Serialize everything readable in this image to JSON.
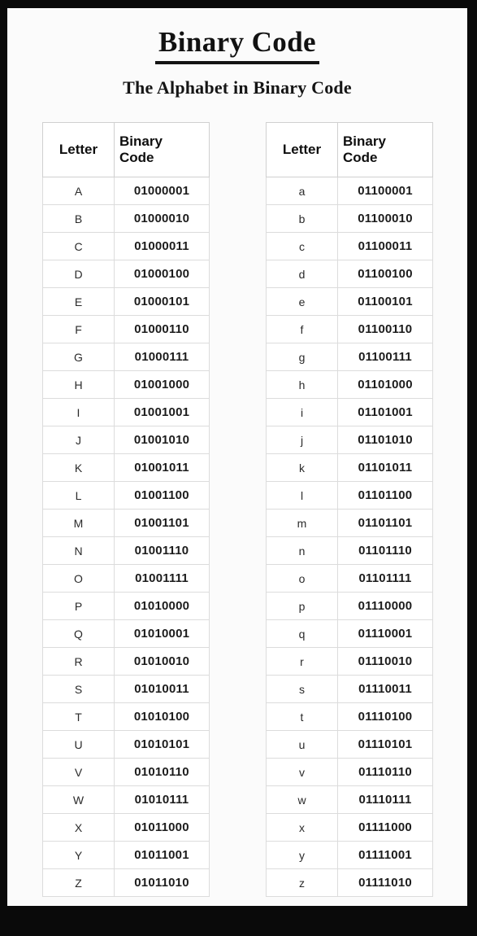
{
  "poster": {
    "title": "Binary Code",
    "subtitle": "The Alphabet in Binary Code",
    "frame_color": "#0a0a0a",
    "sheet_color": "#fbfbfb",
    "text_color": "#121212"
  },
  "tables": [
    {
      "name": "uppercase",
      "headers": {
        "letter": "Letter",
        "code_line1": "Binary",
        "code_line2": "Code"
      },
      "rows": [
        {
          "letter": "A",
          "code": "01000001"
        },
        {
          "letter": "B",
          "code": "01000010"
        },
        {
          "letter": "C",
          "code": "01000011"
        },
        {
          "letter": "D",
          "code": "01000100"
        },
        {
          "letter": "E",
          "code": "01000101"
        },
        {
          "letter": "F",
          "code": "01000110"
        },
        {
          "letter": "G",
          "code": "01000111"
        },
        {
          "letter": "H",
          "code": "01001000"
        },
        {
          "letter": "I",
          "code": "01001001"
        },
        {
          "letter": "J",
          "code": "01001010"
        },
        {
          "letter": "K",
          "code": "01001011"
        },
        {
          "letter": "L",
          "code": "01001100"
        },
        {
          "letter": "M",
          "code": "01001101"
        },
        {
          "letter": "N",
          "code": "01001110"
        },
        {
          "letter": "O",
          "code": "01001111"
        },
        {
          "letter": "P",
          "code": "01010000"
        },
        {
          "letter": "Q",
          "code": "01010001"
        },
        {
          "letter": "R",
          "code": "01010010"
        },
        {
          "letter": "S",
          "code": "01010011"
        },
        {
          "letter": "T",
          "code": "01010100"
        },
        {
          "letter": "U",
          "code": "01010101"
        },
        {
          "letter": "V",
          "code": "01010110"
        },
        {
          "letter": "W",
          "code": "01010111"
        },
        {
          "letter": "X",
          "code": "01011000"
        },
        {
          "letter": "Y",
          "code": "01011001"
        },
        {
          "letter": "Z",
          "code": "01011010"
        }
      ]
    },
    {
      "name": "lowercase",
      "headers": {
        "letter": "Letter",
        "code_line1": "Binary",
        "code_line2": "Code"
      },
      "rows": [
        {
          "letter": "a",
          "code": "01100001"
        },
        {
          "letter": "b",
          "code": "01100010"
        },
        {
          "letter": "c",
          "code": "01100011"
        },
        {
          "letter": "d",
          "code": "01100100"
        },
        {
          "letter": "e",
          "code": "01100101"
        },
        {
          "letter": "f",
          "code": "01100110"
        },
        {
          "letter": "g",
          "code": "01100111"
        },
        {
          "letter": "h",
          "code": "01101000"
        },
        {
          "letter": "i",
          "code": "01101001"
        },
        {
          "letter": "j",
          "code": "01101010"
        },
        {
          "letter": "k",
          "code": "01101011"
        },
        {
          "letter": "l",
          "code": "01101100"
        },
        {
          "letter": "m",
          "code": "01101101"
        },
        {
          "letter": "n",
          "code": "01101110"
        },
        {
          "letter": "o",
          "code": "01101111"
        },
        {
          "letter": "p",
          "code": "01110000"
        },
        {
          "letter": "q",
          "code": "01110001"
        },
        {
          "letter": "r",
          "code": "01110010"
        },
        {
          "letter": "s",
          "code": "01110011"
        },
        {
          "letter": "t",
          "code": "01110100"
        },
        {
          "letter": "u",
          "code": "01110101"
        },
        {
          "letter": "v",
          "code": "01110110"
        },
        {
          "letter": "w",
          "code": "01110111"
        },
        {
          "letter": "x",
          "code": "01111000"
        },
        {
          "letter": "y",
          "code": "01111001"
        },
        {
          "letter": "z",
          "code": "01111010"
        }
      ]
    }
  ]
}
